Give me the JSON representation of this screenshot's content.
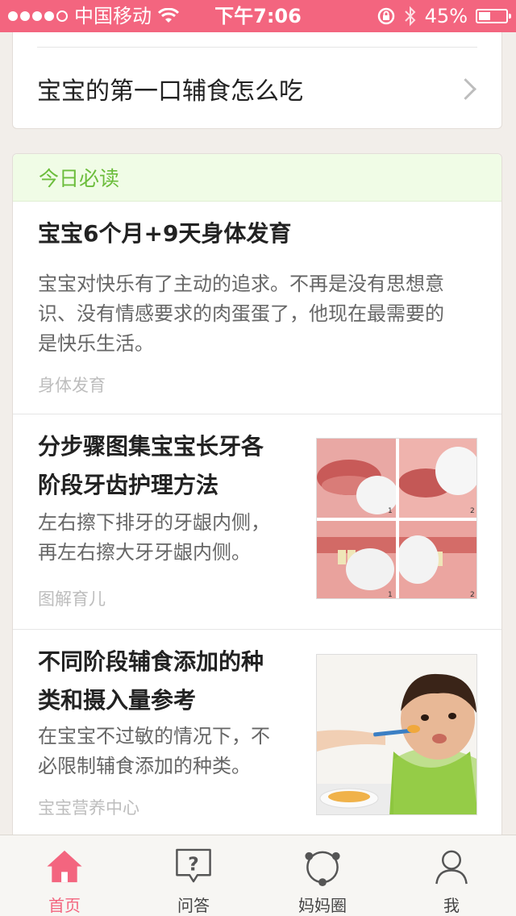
{
  "status_bar": {
    "carrier": "中国移动",
    "time": "下午7:06",
    "battery_percent": "45%",
    "battery_level": 0.45,
    "signal_bars": [
      1,
      1,
      1,
      1,
      0
    ]
  },
  "top_card": {
    "item_label": "宝宝的第一口辅食怎么吃"
  },
  "section": {
    "title": "今日必读"
  },
  "articles": [
    {
      "title": "宝宝6个月+9天身体发育",
      "desc_lines": [
        "宝宝对快乐有了主动的追求。不再是没有思想意",
        "识、没有情感要求的肉蛋蛋了，他现在最需要的",
        "是快乐生活。"
      ],
      "tag": "身体发育"
    },
    {
      "title_lines": [
        "分步骤图集宝宝长牙各",
        "阶段牙齿护理方法"
      ],
      "desc_lines": [
        "左右擦下排牙的牙龈内侧，",
        "再左右擦大牙牙龈内侧。"
      ],
      "tag": "图解育儿",
      "thumb_labels": [
        "1",
        "2",
        "1",
        "2"
      ]
    },
    {
      "title_lines": [
        "不同阶段辅食添加的种",
        "类和摄入量参考"
      ],
      "desc_lines": [
        "在宝宝不过敏的情况下，不",
        "必限制辅食添加的种类。"
      ],
      "tag": "宝宝营养中心"
    }
  ],
  "tab_bar": {
    "tabs": [
      {
        "label": "首页",
        "icon": "home-icon",
        "active": true
      },
      {
        "label": "问答",
        "icon": "question-icon",
        "active": false
      },
      {
        "label": "妈妈圈",
        "icon": "circle-network-icon",
        "active": false
      },
      {
        "label": "我",
        "icon": "person-icon",
        "active": false
      }
    ],
    "active_color": "#f3657f"
  },
  "colors": {
    "brand": "#f3657f",
    "section_green": "#6cbd3c"
  }
}
